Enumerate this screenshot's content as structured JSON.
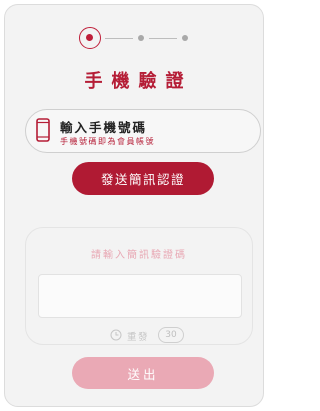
{
  "steps": {
    "current": 1,
    "total": 3
  },
  "title": "手機驗證",
  "phone": {
    "label": "輸入手機號碼",
    "hint": "手機號碼即為會員帳號"
  },
  "send_sms_button": "發送簡訊認證",
  "verify": {
    "prompt": "請輸入簡訊驗證碼",
    "code_value": "",
    "resend_label": "重發",
    "countdown": "30"
  },
  "submit_button": "送出",
  "colors": {
    "brand": "#b01a33",
    "brand_disabled": "#eaa9b5",
    "hint_text": "#b51d36"
  }
}
